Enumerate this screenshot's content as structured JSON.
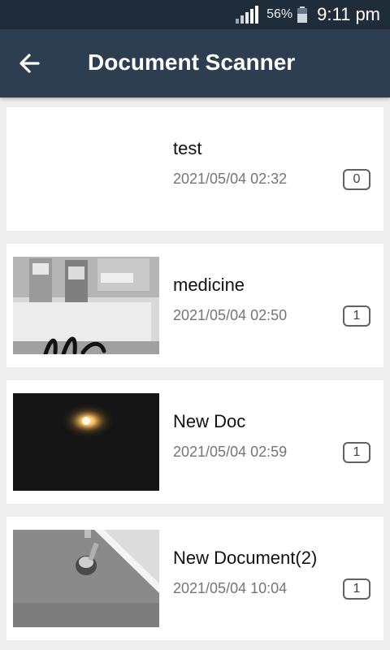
{
  "status_bar": {
    "battery_percent": "56%",
    "time": "9:11 pm",
    "icons": [
      "signal-icon",
      "battery-icon"
    ]
  },
  "app_bar": {
    "title": "Document Scanner",
    "back_icon": "arrow-back-icon"
  },
  "documents": [
    {
      "name": "test",
      "date": "2021/05/04 02:32",
      "page_count": "0",
      "thumbnail": "empty"
    },
    {
      "name": "medicine",
      "date": "2021/05/04 02:50",
      "page_count": "1",
      "thumbnail": "medicine-box-photo"
    },
    {
      "name": "New Doc",
      "date": "2021/05/04 02:59",
      "page_count": "1",
      "thumbnail": "dark-light-photo"
    },
    {
      "name": "New Document(2)",
      "date": "2021/05/04 10:04",
      "page_count": "1",
      "thumbnail": "gray-surface-photo"
    }
  ],
  "colors": {
    "status_bar": "#1f2c3a",
    "app_bar": "#2c3e50",
    "background": "#eeeeee",
    "card": "#ffffff"
  }
}
